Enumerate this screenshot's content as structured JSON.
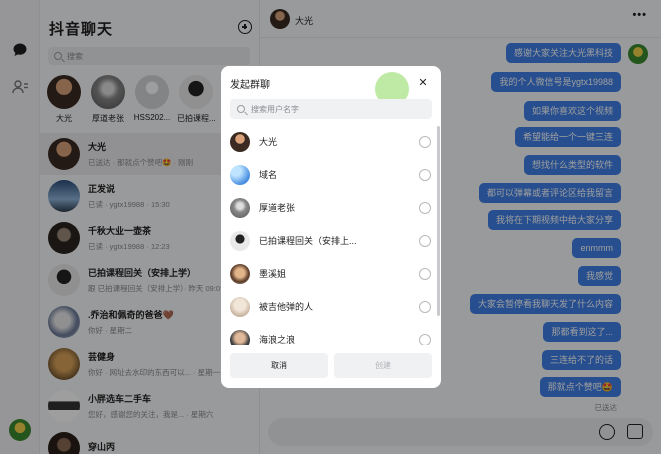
{
  "sidebar_title": "抖音聊天",
  "search_placeholder": "搜索",
  "recent": [
    {
      "name": "大光"
    },
    {
      "name": "厚道老张"
    },
    {
      "name": "HSS202..."
    },
    {
      "name": "已拍课程..."
    }
  ],
  "conversations": [
    {
      "name": "大光",
      "sub": "已送达 · 那就点个赞吧🤩 · 刚刚"
    },
    {
      "name": "正发说",
      "sub": "已读 · ygtx19988 · 15:30"
    },
    {
      "name": "千秋大业一壶茶",
      "sub": "已读 · ygtx19988 · 12:23"
    },
    {
      "name": "已拍课程回关（安排上学）",
      "sub": "跟 已拍课程回关（安排上学）· 昨天 09:07"
    },
    {
      "name": ".乔治和佩奇的爸爸🤎",
      "sub": "你好 · 星期二"
    },
    {
      "name": "芸健身",
      "sub": "你好 · 网址去水印的东西可以... · 星期一"
    },
    {
      "name": "小胖选车二手车",
      "sub": "您好，感谢您的关注，我是... · 星期六"
    },
    {
      "name": "穿山丙",
      "sub": ""
    }
  ],
  "chat": {
    "contact_name": "大光",
    "more": "•••",
    "messages": [
      "感谢大家关注大光黑科技",
      "我的个人微信号是ygtx19988",
      "如果你喜欢这个视频",
      "希望能给一个一键三连",
      "想找什么类型的软件",
      "都可以弹幕或者评论区给我留言",
      "我将在下期视频中给大家分享",
      "enmmm",
      "我感觉",
      "大家会暂停看我聊天发了什么内容",
      "那都看到这了...",
      "三连给不了的话",
      "那就点个赞吧🤩"
    ],
    "read_status": "已送达"
  },
  "modal": {
    "title": "发起群聊",
    "close": "✕",
    "search_placeholder": "搜索用户名字",
    "contacts": [
      {
        "name": "大光"
      },
      {
        "name": "域名"
      },
      {
        "name": "厚道老张"
      },
      {
        "name": "已拍课程回关（安排上..."
      },
      {
        "name": "墨溪姐"
      },
      {
        "name": "被吉他弹的人"
      },
      {
        "name": "海浪之浪"
      }
    ],
    "cancel_label": "取消",
    "create_label": "创建"
  }
}
